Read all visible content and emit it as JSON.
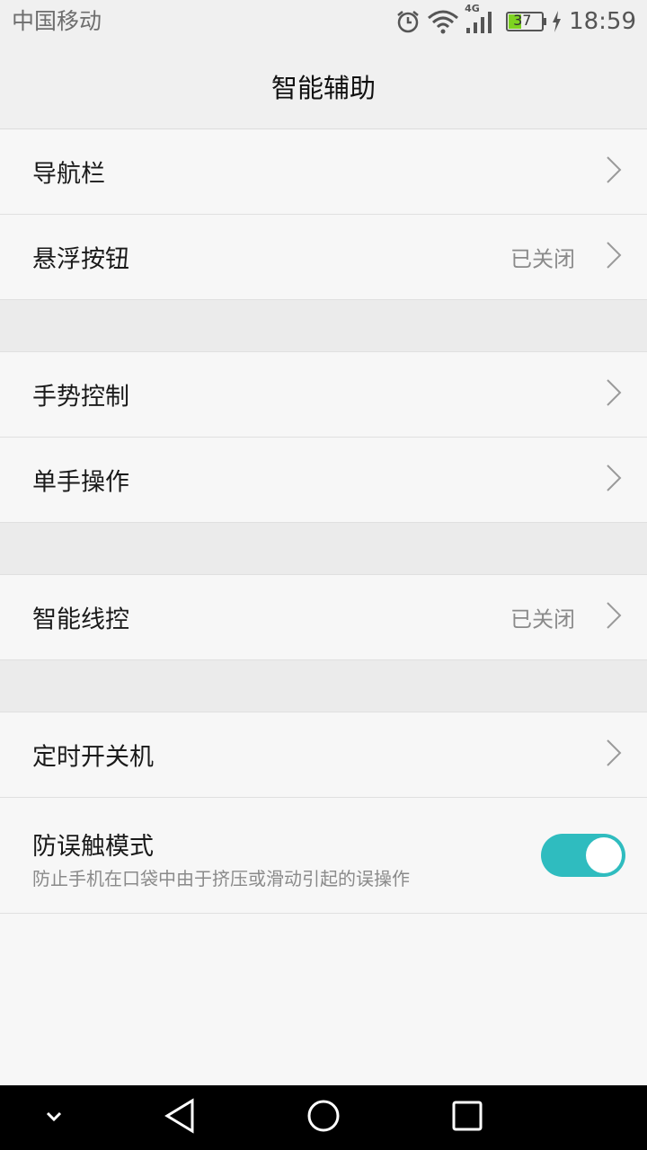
{
  "status_bar": {
    "carrier": "中国移动",
    "network": "4G",
    "battery": "37",
    "time": "18:59",
    "icons": [
      "alarm-icon",
      "wifi-icon",
      "signal-icon",
      "battery-icon",
      "charging-icon"
    ]
  },
  "header": {
    "title": "智能辅助"
  },
  "settings": {
    "nav_bar": {
      "label": "导航栏"
    },
    "float_button": {
      "label": "悬浮按钮",
      "value": "已关闭"
    },
    "gesture": {
      "label": "手势控制"
    },
    "one_hand": {
      "label": "单手操作"
    },
    "smart_wire": {
      "label": "智能线控",
      "value": "已关闭"
    },
    "scheduled_power": {
      "label": "定时开关机"
    },
    "pocket_mode": {
      "label": "防误触模式",
      "description": "防止手机在口袋中由于挤压或滑动引起的误操作",
      "enabled": true
    }
  },
  "colors": {
    "toggle_on": "#2fbcbf",
    "background": "#f7f7f7",
    "nav_bar": "#000000"
  },
  "nav_bar": {
    "icons": [
      "chevron-down-icon",
      "back-icon",
      "home-icon",
      "recents-icon"
    ]
  }
}
